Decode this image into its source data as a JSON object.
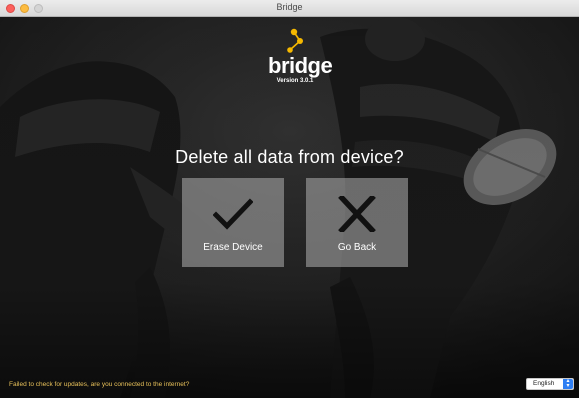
{
  "window": {
    "title": "Bridge"
  },
  "logo": {
    "wordmark": "bridge",
    "version": "Version 3.0.1",
    "accent_color": "#f5b800"
  },
  "dialog": {
    "question": "Delete all data from device?",
    "erase_label": "Erase Device",
    "erase_icon": "checkmark-icon",
    "back_label": "Go Back",
    "back_icon": "x-icon"
  },
  "footer": {
    "status_message": "Failed to check for updates, are you connected to the internet?",
    "status_color": "#e8c15a",
    "language_selected": "English"
  }
}
